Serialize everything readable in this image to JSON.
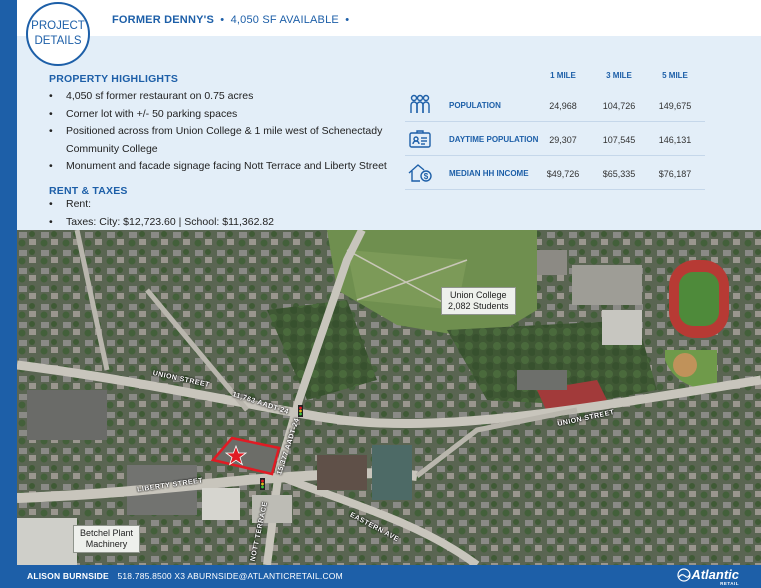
{
  "badge": {
    "line1": "PROJECT",
    "line2": "DETAILS"
  },
  "header": {
    "title": "FORMER DENNY'S",
    "separator": "•",
    "subtitle": "4,050 SF AVAILABLE",
    "trailing": "•"
  },
  "highlights": {
    "heading": "PROPERTY HIGHLIGHTS",
    "items": [
      "4,050 sf former restaurant on 0.75 acres",
      "Corner lot with +/- 50 parking spaces",
      "Positioned across from Union College & 1 mile west of Schenectady",
      "Community College",
      "Monument and facade signage facing Nott Terrace and Liberty Street"
    ]
  },
  "rent": {
    "heading": "RENT & TAXES",
    "items": [
      "Rent:",
      "Taxes: City: $12,723.60  | School: $11,362.82"
    ]
  },
  "demographics": {
    "columns": [
      "1 MILE",
      "3 MILE",
      "5 MILE"
    ],
    "rows": [
      {
        "icon": "population-icon",
        "label": "POPULATION",
        "values": [
          "24,968",
          "104,726",
          "149,675"
        ]
      },
      {
        "icon": "id-card-icon",
        "label": "DAYTIME POPULATION",
        "values": [
          "29,307",
          "107,545",
          "146,131"
        ]
      },
      {
        "icon": "house-dollar-icon",
        "label": "MEDIAN HH INCOME",
        "values": [
          "$49,726",
          "$65,335",
          "$76,187"
        ]
      }
    ]
  },
  "map": {
    "callouts": {
      "college_name": "Union College",
      "college_students": "2,082 Students",
      "plant_name": "Betchel Plant",
      "plant_sub": "Machinery"
    },
    "streets": {
      "union_west": "UNION STREET",
      "union_east": "UNION STREET",
      "liberty": "LIBERTY STREET",
      "nott": "NOTT TERRACE",
      "eastern": "EASTERN AVE",
      "aadt_1": "11,763 AADT-24",
      "aadt_2": "15,377 AADT-24"
    }
  },
  "footer": {
    "name": "ALISON BURNSIDE",
    "phone": "518.785.8500 X3",
    "email": "ABURNSIDE@ATLANTICRETAIL.COM",
    "logo": "Atlantic",
    "logo_sub": "RETAIL"
  },
  "colors": {
    "brand_blue": "#1d5fa8",
    "panel_blue": "#e3eef8",
    "marker_red": "#e01b24"
  }
}
